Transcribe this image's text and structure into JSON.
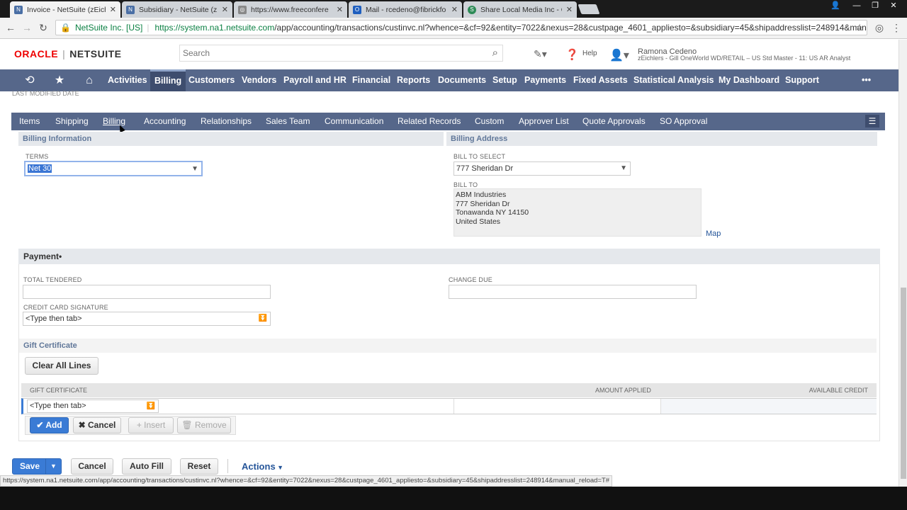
{
  "browser": {
    "tabs": [
      {
        "title": "Invoice - NetSuite (zEichl",
        "favicon": "N",
        "active": true
      },
      {
        "title": "Subsidiary - NetSuite (zE",
        "favicon": "N",
        "active": false
      },
      {
        "title": "https://www.freeconfere",
        "favicon": "◎",
        "active": false
      },
      {
        "title": "Mail - rcedeno@fibrickfo",
        "favicon": "O",
        "active": false
      },
      {
        "title": "Share Local Media Inc - G",
        "favicon": "S",
        "active": false
      }
    ],
    "secure_label": "NetSuite Inc. [US]",
    "url_host": "https://system.na1.netsuite.com",
    "url_path": "/app/accounting/transactions/custinvc.nl?whence=&cf=92&entity=7022&nexus=28&custpage_4601_appliesto=&subsidiary=45&shipaddresslist=248914&manua"
  },
  "header": {
    "logo_oracle": "ORACLE",
    "logo_sep": "|",
    "logo_netsuite": "NETSUITE",
    "search_placeholder": "Search",
    "help_label": "Help",
    "user_name": "Ramona Cedeno",
    "user_role": "zEichlers - Gill OneWorld WD/RETAIL – US Std Master - 11: US AR Analyst"
  },
  "main_nav": {
    "items": [
      "Activities",
      "Billing",
      "Customers",
      "Vendors",
      "Payroll and HR",
      "Financial",
      "Reports",
      "Documents",
      "Setup",
      "Payments",
      "Fixed Assets",
      "Statistical Analysis",
      "My Dashboard",
      "Support"
    ],
    "active": "Billing",
    "more": "•••"
  },
  "last_modified_label": "LAST MODIFIED DATE",
  "subtabs": {
    "items": [
      "Items",
      "Shipping",
      "Billing",
      "Accounting",
      "Relationships",
      "Sales Team",
      "Communication",
      "Related Records",
      "Custom",
      "Approver List",
      "Quote Approvals",
      "SO Approval"
    ],
    "active": "Billing"
  },
  "billing_info": {
    "heading": "Billing Information",
    "terms_label": "TERMS",
    "terms_value": "Net 30"
  },
  "billing_address": {
    "heading": "Billing Address",
    "bill_to_select_label": "BILL TO SELECT",
    "bill_to_select_value": "777 Sheridan Dr",
    "bill_to_label": "BILL TO",
    "bill_to_lines": [
      "ABM Industries",
      "777 Sheridan Dr",
      "Tonawanda NY 14150",
      "United States"
    ],
    "map_link": "Map"
  },
  "payment": {
    "heading": "Payment",
    "required_mark": "•",
    "total_tendered_label": "TOTAL TENDERED",
    "total_tendered_value": "",
    "change_due_label": "CHANGE DUE",
    "change_due_value": "",
    "cc_signature_label": "CREDIT CARD SIGNATURE",
    "cc_signature_value": "<Type then tab>"
  },
  "gift_certificate": {
    "heading": "Gift Certificate",
    "clear_all_lines": "Clear All Lines",
    "columns": [
      "GIFT CERTIFICATE",
      "AMOUNT APPLIED",
      "AVAILABLE CREDIT"
    ],
    "row_placeholder": "<Type then tab>",
    "add": "Add",
    "cancel": "Cancel",
    "insert": "Insert",
    "remove": "Remove"
  },
  "footer_buttons": {
    "save": "Save",
    "cancel": "Cancel",
    "auto_fill": "Auto Fill",
    "reset": "Reset",
    "actions": "Actions"
  },
  "status_url": "https://system.na1.netsuite.com/app/accounting/transactions/custinvc.nl?whence=&cf=92&entity=7022&nexus=28&custpage_4601_appliesto=&subsidiary=45&shipaddresslist=248914&manual_reload=T#",
  "colors": {
    "nav_bg": "#56678a",
    "nav_active": "#3e4d6e",
    "primary_button": "#3a7bd5",
    "oracle_red": "#ee0000",
    "link": "#255599"
  }
}
